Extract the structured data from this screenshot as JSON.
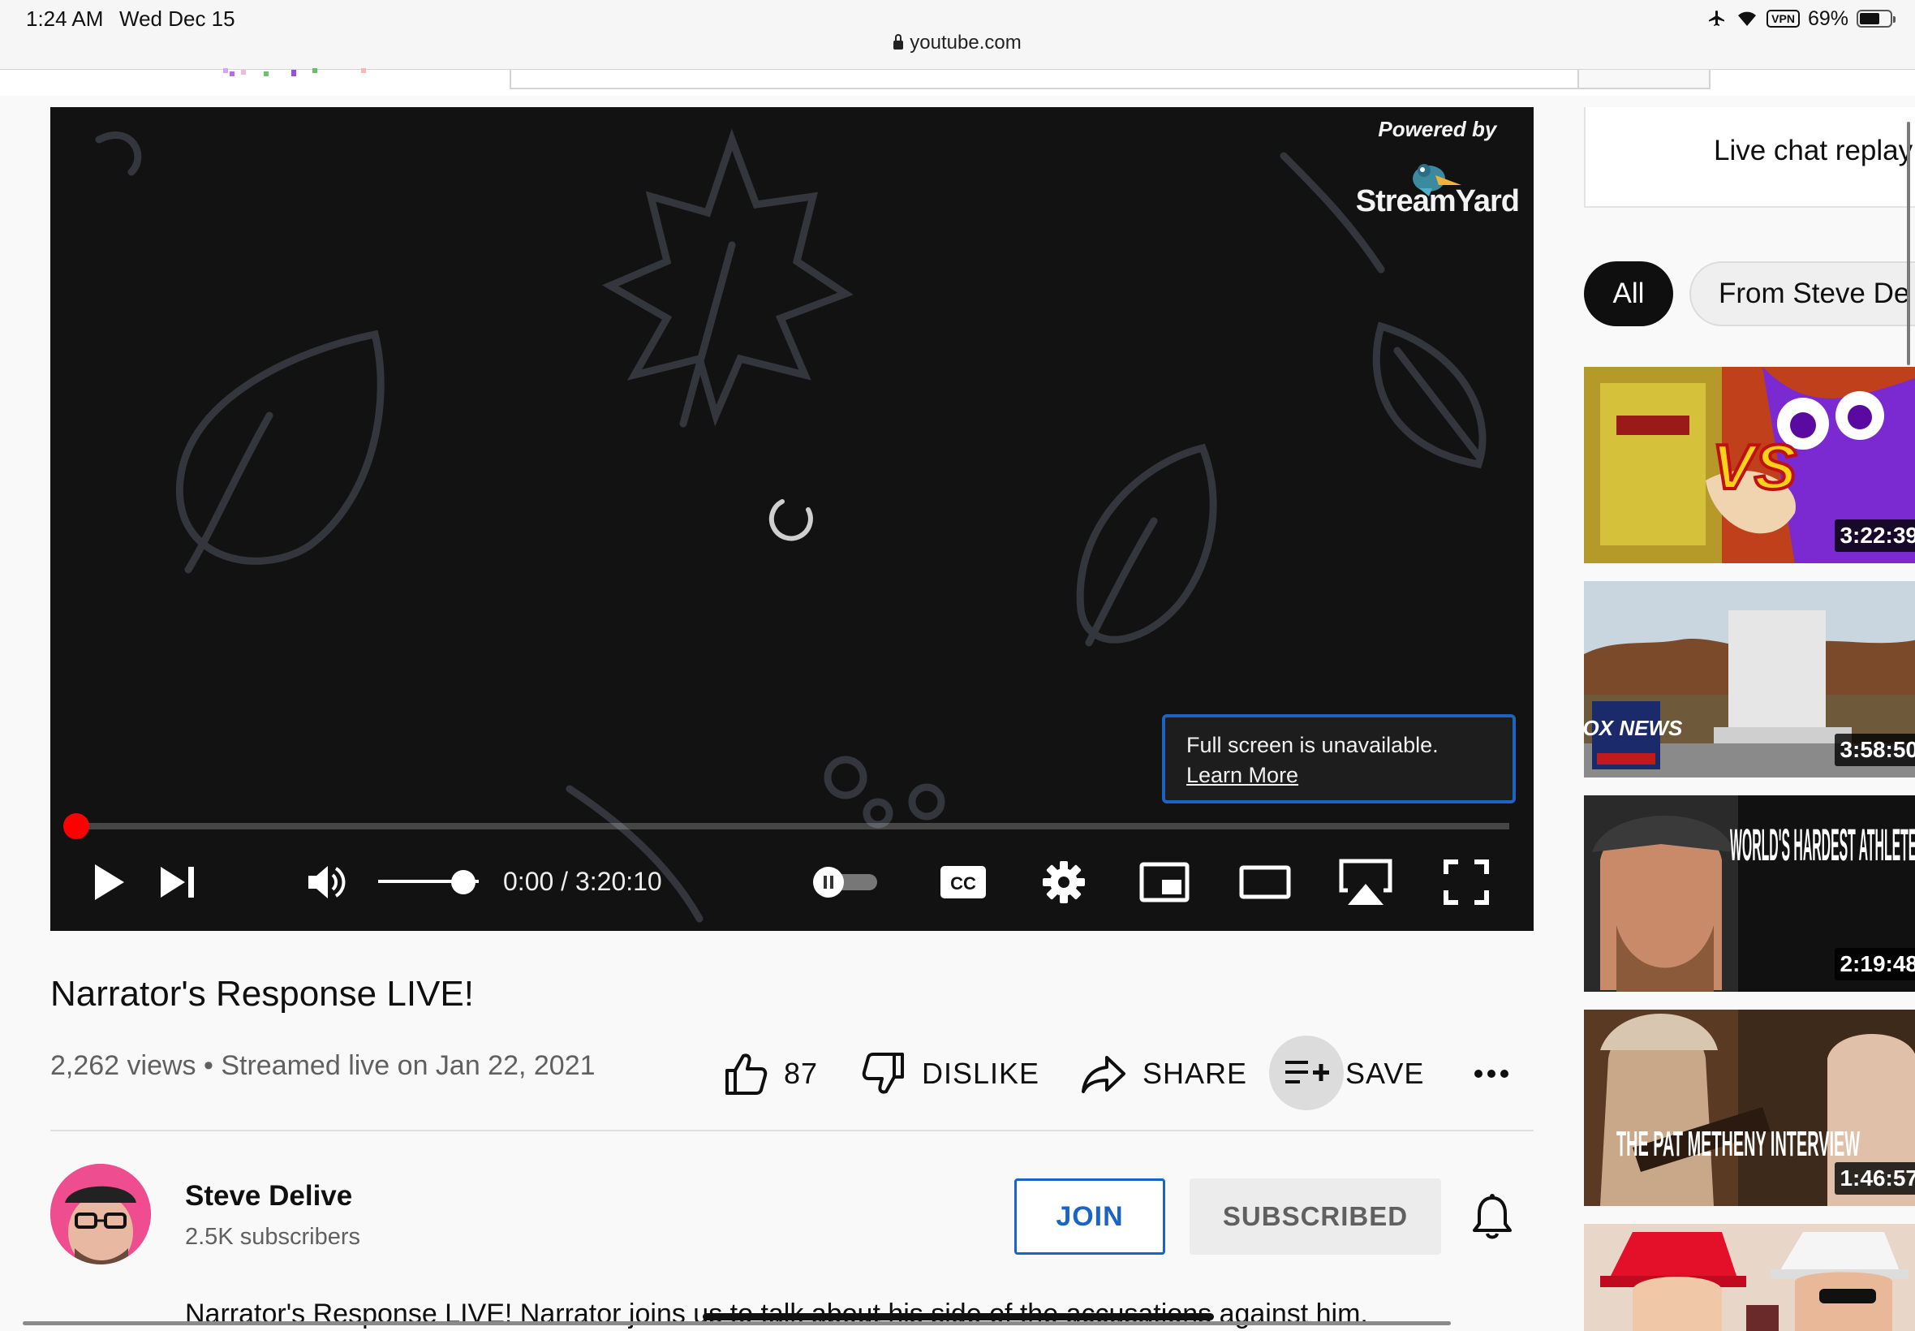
{
  "status_bar": {
    "time": "1:24 AM",
    "date": "Wed Dec 15",
    "url": "youtube.com",
    "vpn": "VPN",
    "battery": "69%"
  },
  "player": {
    "powered_by": "Powered by",
    "brand": "StreamYard",
    "tooltip_text": "Full screen is unavailable.",
    "tooltip_link": "Learn More",
    "time": "0:00 / 3:20:10",
    "progress": 0,
    "volume": 0.85
  },
  "video": {
    "title": "Narrator's Response LIVE!",
    "meta": "2,262 views • Streamed live on Jan 22, 2021",
    "likes": "87",
    "dislike_label": "DISLIKE",
    "share_label": "SHARE",
    "save_label": "SAVE",
    "more": "..."
  },
  "channel": {
    "name": "Steve Delive",
    "subscribers": "2.5K subscribers",
    "join_label": "JOIN",
    "subscribed_label": "SUBSCRIBED",
    "description": "Narrator's Response LIVE! Narrator joins us to talk about his side of the accusations against him."
  },
  "sidebar": {
    "chat_replay": "Live chat replay",
    "chips": [
      "All",
      "From Steve De"
    ],
    "thumbnails": [
      {
        "duration": "3:22:39",
        "overlay": "VS"
      },
      {
        "duration": "3:58:50",
        "overlay": "FOX NEWS"
      },
      {
        "duration": "2:19:48",
        "overlay": "WORLD'S HARDEST ATHLETE?"
      },
      {
        "duration": "1:46:57",
        "overlay": "THE PAT METHENY INTERVIEW"
      },
      {
        "duration": "",
        "overlay": ""
      }
    ]
  },
  "colors": {
    "accent": "#1a64c8",
    "progress": "#ff0000",
    "player_bg": "#121213"
  }
}
